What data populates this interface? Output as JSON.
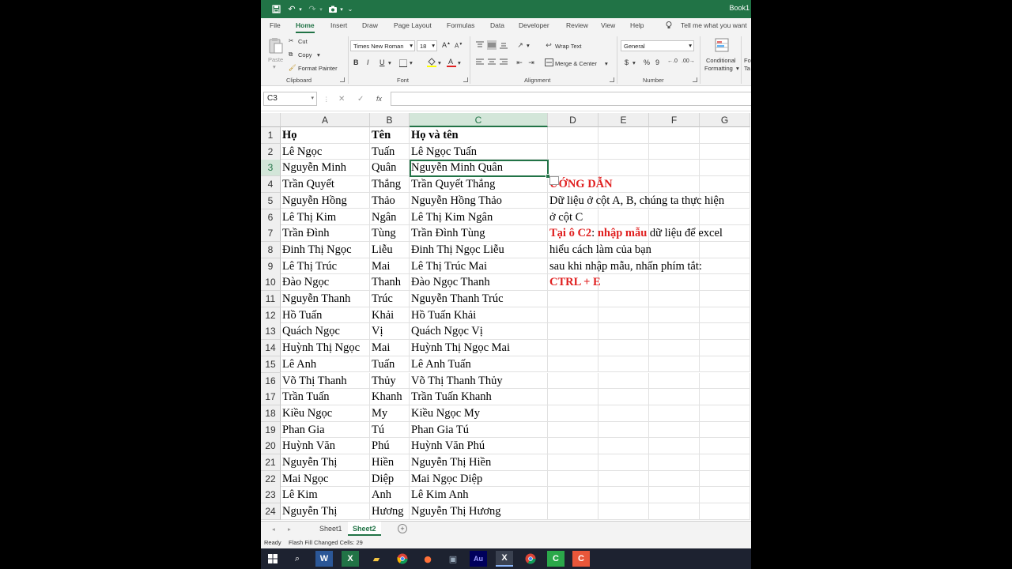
{
  "window": {
    "title": "Book1"
  },
  "ribbon": {
    "tabs": [
      "File",
      "Home",
      "Insert",
      "Draw",
      "Page Layout",
      "Formulas",
      "Data",
      "Developer",
      "Review",
      "View",
      "Help"
    ],
    "tell_me": "Tell me what you want",
    "clipboard": {
      "paste": "Paste",
      "cut": "Cut",
      "copy": "Copy",
      "format_painter": "Format Painter",
      "label": "Clipboard"
    },
    "font": {
      "name": "Times New Roman",
      "size": "18",
      "bold": "B",
      "italic": "I",
      "underline": "U",
      "label": "Font"
    },
    "alignment": {
      "wrap_text": "Wrap Text",
      "merge_center": "Merge & Center",
      "label": "Alignment"
    },
    "number": {
      "format": "General",
      "currency": "$",
      "percent": "%",
      "comma": "9",
      "label": "Number"
    },
    "styles": {
      "conditional_1": "Conditional",
      "conditional_2": "Formatting",
      "fmt_1": "Fo",
      "fmt_2": "Ta"
    }
  },
  "formula_bar": {
    "name_box": "C3",
    "fx": "fx"
  },
  "columns": [
    "A",
    "B",
    "C",
    "D",
    "E",
    "F",
    "G"
  ],
  "rows": [
    {
      "n": "1",
      "a": "Họ",
      "b": "Tên",
      "c": "Họ và tên",
      "d": ""
    },
    {
      "n": "2",
      "a": "Lê Ngọc",
      "b": "Tuấn",
      "c": "Lê Ngọc Tuấn",
      "d": ""
    },
    {
      "n": "3",
      "a": "Nguyễn Minh",
      "b": "Quân",
      "c": "Nguyễn Minh Quân",
      "d": ""
    },
    {
      "n": "4",
      "a": "Trần Quyết",
      "b": "Thắng",
      "c": "Trần Quyết Thắng",
      "d": "ƯỚNG DẪN"
    },
    {
      "n": "5",
      "a": "Nguyễn Hồng",
      "b": "Thảo",
      "c": "Nguyễn Hồng Thảo",
      "d": "Dữ liệu ở cột A, B, chúng ta thực hiện"
    },
    {
      "n": "6",
      "a": "Lê Thị Kim",
      "b": "Ngân",
      "c": "Lê Thị Kim Ngân",
      "d": "ở cột C"
    },
    {
      "n": "7",
      "a": "Trần Đình",
      "b": "Tùng",
      "c": "Trần Đình Tùng",
      "d": ""
    },
    {
      "n": "8",
      "a": "Đinh Thị Ngọc",
      "b": "Liễu",
      "c": "Đinh Thị Ngọc Liễu",
      "d": "hiểu cách làm của bạn"
    },
    {
      "n": "9",
      "a": "Lê Thị Trúc",
      "b": "Mai",
      "c": "Lê Thị Trúc Mai",
      "d": "sau khi nhập mẫu, nhấn phím tắt:"
    },
    {
      "n": "10",
      "a": "Đào Ngọc",
      "b": "Thanh",
      "c": "Đào Ngọc Thanh",
      "d": "CTRL + E"
    },
    {
      "n": "11",
      "a": "Nguyễn Thanh",
      "b": "Trúc",
      "c": "Nguyễn Thanh Trúc",
      "d": ""
    },
    {
      "n": "12",
      "a": "Hồ Tuấn",
      "b": "Khải",
      "c": "Hồ Tuấn Khải",
      "d": ""
    },
    {
      "n": "13",
      "a": "Quách Ngọc",
      "b": "Vị",
      "c": "Quách Ngọc Vị",
      "d": ""
    },
    {
      "n": "14",
      "a": "Huỳnh Thị Ngọc",
      "b": "Mai",
      "c": "Huỳnh Thị Ngọc Mai",
      "d": ""
    },
    {
      "n": "15",
      "a": "Lê Anh",
      "b": "Tuấn",
      "c": "Lê Anh Tuấn",
      "d": ""
    },
    {
      "n": "16",
      "a": "Võ Thị Thanh",
      "b": "Thủy",
      "c": "Võ Thị Thanh Thủy",
      "d": ""
    },
    {
      "n": "17",
      "a": "Trần Tuấn",
      "b": "Khanh",
      "c": "Trần Tuấn Khanh",
      "d": ""
    },
    {
      "n": "18",
      "a": "Kiều Ngọc",
      "b": "My",
      "c": "Kiều Ngọc My",
      "d": ""
    },
    {
      "n": "19",
      "a": "Phan Gia",
      "b": "Tú",
      "c": "Phan Gia Tú",
      "d": ""
    },
    {
      "n": "20",
      "a": "Huỳnh Văn",
      "b": "Phú",
      "c": "Huỳnh Văn Phú",
      "d": ""
    },
    {
      "n": "21",
      "a": "Nguyễn Thị",
      "b": "Hiền",
      "c": "Nguyễn Thị Hiền",
      "d": ""
    },
    {
      "n": "22",
      "a": "Mai Ngọc",
      "b": "Diệp",
      "c": "Mai Ngọc Diệp",
      "d": ""
    },
    {
      "n": "23",
      "a": "Lê Kim",
      "b": "Anh",
      "c": "Lê Kim Anh",
      "d": ""
    },
    {
      "n": "24",
      "a": "Nguyễn Thị",
      "b": "Hương",
      "c": "Nguyễn Thị Hương",
      "d": ""
    }
  ],
  "instruction_row7": {
    "part1": "Tại ô C2",
    "part2": ": ",
    "part3": "nhập mẫu",
    "part4": " dữ liệu để excel"
  },
  "sheets": [
    "Sheet1",
    "Sheet2"
  ],
  "status": {
    "ready": "Ready",
    "message": "Flash Fill Changed Cells: 29"
  },
  "colors": {
    "excel_green": "#217346",
    "accent_red": "#e02020"
  }
}
